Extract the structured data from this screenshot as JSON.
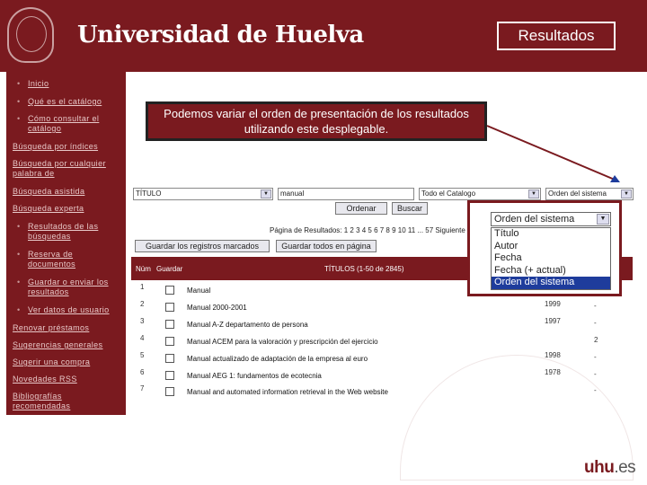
{
  "header": {
    "logo_text": "Universidad de Huelva",
    "slide_title": "Resultados"
  },
  "sidebar": {
    "items": [
      {
        "label": "Inicio"
      },
      {
        "label": "Qué es el catálogo"
      },
      {
        "label": "Cómo consultar el catálogo"
      },
      {
        "label": "Búsqueda por índices"
      },
      {
        "label": "Búsqueda por cualquier palabra de"
      },
      {
        "label": "Búsqueda asistida"
      },
      {
        "label": "Búsqueda experta"
      },
      {
        "label": "Resultados de las búsquedas"
      },
      {
        "label": "Reserva de documentos"
      },
      {
        "label": "Guardar o enviar los resultados"
      },
      {
        "label": "Ver datos de usuario"
      },
      {
        "label": "Renovar préstamos"
      },
      {
        "label": "Sugerencias generales"
      },
      {
        "label": "Sugerir una compra"
      },
      {
        "label": "Novedades RSS"
      },
      {
        "label": "Bibliografías recomendadas"
      }
    ]
  },
  "callout": {
    "text": "Podemos variar el orden de presentación de los resultados utilizando este desplegable."
  },
  "search": {
    "field_select": "TÍTULO",
    "query": "manual",
    "catalog_select": "Todo el Catalogo",
    "order_select": "Orden del sistema",
    "order_button": "Ordenar",
    "search_button": "Buscar",
    "pagination": "Página de Resultados: 1 2 3 4 5 6 7 8 9 10 11 ... 57 Siguiente",
    "save_marked_button": "Guardar los registros marcados",
    "save_page_button": "Guardar todos en página"
  },
  "table": {
    "col_num": "Núm",
    "col_save": "Guardar",
    "col_titles": "TÍTULOS (1-50 de 2845)",
    "rows": [
      {
        "num": "1",
        "title": "Manual",
        "year": "",
        "copies": "-"
      },
      {
        "num": "2",
        "title": "Manual 2000-2001",
        "year": "1999",
        "copies": "-"
      },
      {
        "num": "3",
        "title": "Manual A-Z departamento de persona",
        "year": "1997",
        "copies": "-"
      },
      {
        "num": "4",
        "title": "Manual ACEM para la valoración y prescripción del ejercicio",
        "year": "",
        "copies": "2"
      },
      {
        "num": "5",
        "title": "Manual actualizado de adaptación de la empresa al euro",
        "year": "1998",
        "copies": "-"
      },
      {
        "num": "6",
        "title": "Manual AEG 1: fundamentos de ecotecnia",
        "year": "1978",
        "copies": "-"
      },
      {
        "num": "7",
        "title": "Manual and automated information retrieval in the Web website",
        "year": "",
        "copies": "-"
      }
    ]
  },
  "zoom": {
    "selected": "Orden del sistema",
    "options": [
      "Título",
      "Autor",
      "Fecha",
      "Fecha (+ actual)",
      "Orden del sistema"
    ],
    "active_index": 4
  },
  "footer": {
    "brand": "uhu",
    "brand_suffix": ".es"
  }
}
